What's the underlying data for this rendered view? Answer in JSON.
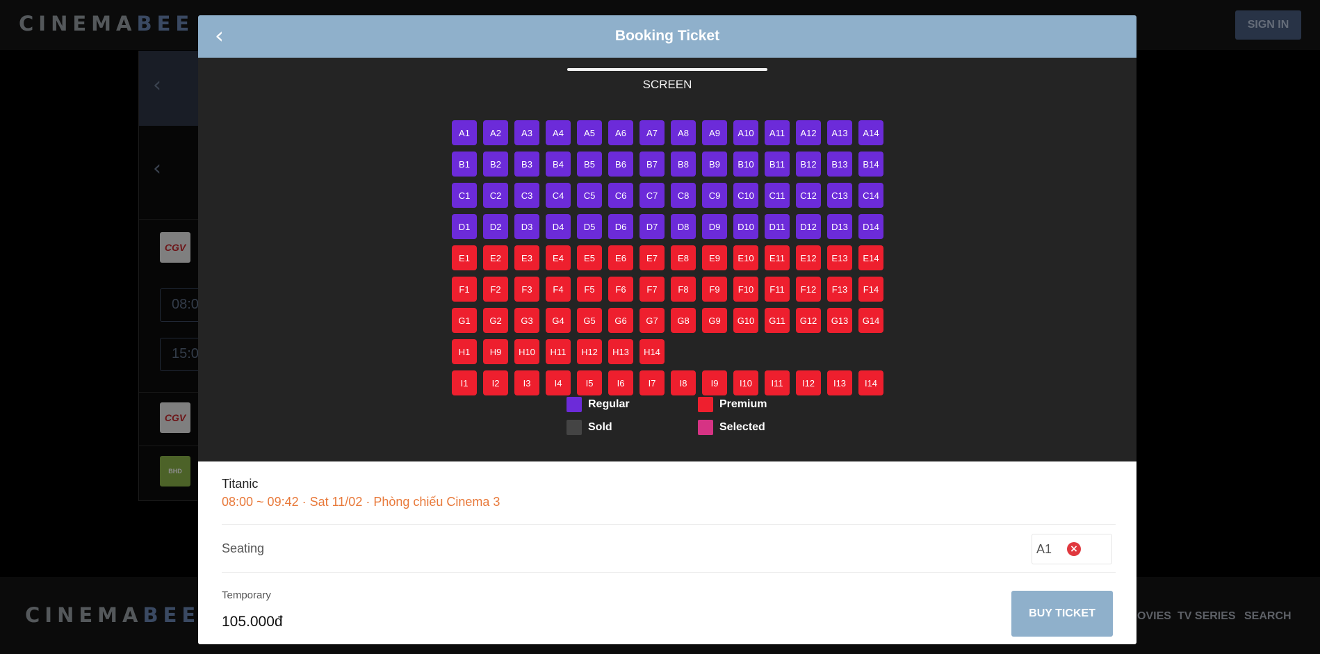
{
  "site": {
    "logo_part1": "CINEMA",
    "logo_part2": "BEE",
    "sign_in": "SIGN IN",
    "footer_nav": [
      "OVIES",
      "TV SERIES",
      "SEARCH"
    ]
  },
  "background": {
    "times": [
      "08:0",
      "15:0"
    ],
    "cinema_badges": [
      "CGV",
      "CGV",
      "BHD"
    ]
  },
  "modal": {
    "title": "Booking Ticket",
    "screen_label": "SCREEN",
    "seat_rows": [
      {
        "type": "regular",
        "seats": [
          "A1",
          "A2",
          "A3",
          "A4",
          "A5",
          "A6",
          "A7",
          "A8",
          "A9",
          "A10",
          "A11",
          "A12",
          "A13",
          "A14"
        ]
      },
      {
        "type": "regular",
        "seats": [
          "B1",
          "B2",
          "B3",
          "B4",
          "B5",
          "B6",
          "B7",
          "B8",
          "B9",
          "B10",
          "B11",
          "B12",
          "B13",
          "B14"
        ]
      },
      {
        "type": "regular",
        "seats": [
          "C1",
          "C2",
          "C3",
          "C4",
          "C5",
          "C6",
          "C7",
          "C8",
          "C9",
          "C10",
          "C11",
          "C12",
          "C13",
          "C14"
        ]
      },
      {
        "type": "regular",
        "seats": [
          "D1",
          "D2",
          "D3",
          "D4",
          "D5",
          "D6",
          "D7",
          "D8",
          "D9",
          "D10",
          "D11",
          "D12",
          "D13",
          "D14"
        ]
      },
      {
        "type": "premium",
        "seats": [
          "E1",
          "E2",
          "E3",
          "E4",
          "E5",
          "E6",
          "E7",
          "E8",
          "E9",
          "E10",
          "E11",
          "E12",
          "E13",
          "E14"
        ]
      },
      {
        "type": "premium",
        "seats": [
          "F1",
          "F2",
          "F3",
          "F4",
          "F5",
          "F6",
          "F7",
          "F8",
          "F9",
          "F10",
          "F11",
          "F12",
          "F13",
          "F14"
        ]
      },
      {
        "type": "premium",
        "seats": [
          "G1",
          "G2",
          "G3",
          "G4",
          "G5",
          "G6",
          "G7",
          "G8",
          "G9",
          "G10",
          "G11",
          "G12",
          "G13",
          "G14"
        ]
      },
      {
        "type": "premium",
        "seats": [
          "H1",
          "H9",
          "H10",
          "H11",
          "H12",
          "H13",
          "H14"
        ]
      },
      {
        "type": "premium",
        "seats": [
          "I1",
          "I2",
          "I3",
          "I4",
          "I5",
          "I6",
          "I7",
          "I8",
          "I9",
          "I10",
          "I11",
          "I12",
          "I13",
          "I14"
        ]
      }
    ],
    "legend": [
      {
        "label": "Regular",
        "color": "#6c2bd9"
      },
      {
        "label": "Premium",
        "color": "#ee1f2e"
      },
      {
        "label": "Sold",
        "color": "#444444"
      },
      {
        "label": "Selected",
        "color": "#d63384"
      }
    ]
  },
  "booking": {
    "movie_title": "Titanic",
    "showtime": "08:00 ~ 09:42 · Sat 11/02 · Phòng chiếu Cinema 3",
    "seating_label": "Seating",
    "selected_seat": "A1",
    "temporary_label": "Temporary",
    "price": "105.000đ",
    "buy_label": "BUY TICKET"
  }
}
